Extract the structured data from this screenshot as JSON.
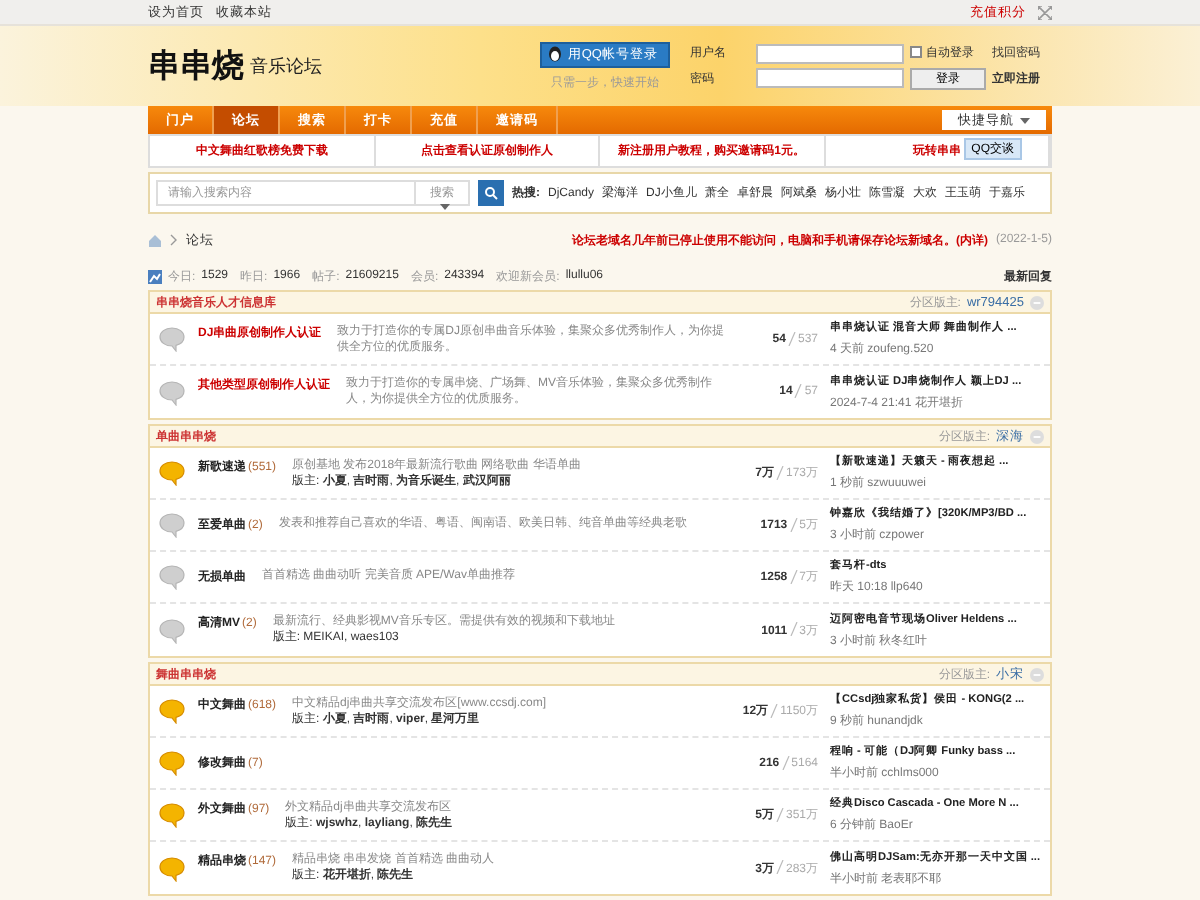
{
  "topbar": {
    "links": [
      "设为首页",
      "收藏本站"
    ],
    "credit_link": "充值积分"
  },
  "header": {
    "logo_main": "串串烧",
    "logo_sub": "音乐论坛",
    "qq_login": "用QQ帐号登录",
    "qq_hint": "只需一步，快速开始",
    "username_label": "用户名",
    "password_label": "密码",
    "auto_login": {
      "label": "自动登录",
      "checked": false
    },
    "find_password": "找回密码",
    "login_button": "登录",
    "register": "立即注册"
  },
  "nav": {
    "items": [
      {
        "label": "门户",
        "selected": false
      },
      {
        "label": "论坛",
        "selected": true
      },
      {
        "label": "搜索",
        "selected": false
      },
      {
        "label": "打卡",
        "selected": false
      },
      {
        "label": "充值",
        "selected": false
      },
      {
        "label": "邀请码",
        "selected": false
      }
    ],
    "quick_nav": "快捷导航"
  },
  "promo": [
    "中文舞曲红歌榜免费下载",
    "点击查看认证原创制作人",
    "新注册用户教程，购买邀请码1元。",
    "玩转串串"
  ],
  "qq_chat": "QQ交谈",
  "search": {
    "placeholder": "请输入搜索内容",
    "scope": "搜索",
    "hot_label": "热搜:",
    "hot": [
      "DjCandy",
      "梁海洋",
      "DJ小鱼儿",
      "萧全",
      "卓舒晨",
      "阿斌桑",
      "杨小壮",
      "陈雪凝",
      "大欢",
      "王玉萌",
      "于嘉乐"
    ]
  },
  "breadcrumb": {
    "current": "论坛",
    "notice": "论坛老域名几年前已停止使用不能访问，电脑和手机请保存论坛新域名。(内详)",
    "date": "(2022-1-5)"
  },
  "stats": [
    {
      "label": "今日:",
      "value": "1529"
    },
    {
      "label": "昨日:",
      "value": "1966"
    },
    {
      "label": "帖子:",
      "value": "21609215"
    },
    {
      "label": "会员:",
      "value": "243394"
    },
    {
      "label": "欢迎新会员:",
      "value": "llullu06"
    }
  ],
  "latest_reply": "最新回复",
  "sections": [
    {
      "title": "串串烧音乐人才信息库",
      "moderator_label": "分区版主:",
      "moderator": "wr794425",
      "expanded": true,
      "forums": [
        {
          "kind": "old",
          "highlight": true,
          "name": "DJ串曲原创制作人认证",
          "desc": "致力于打造你的专属DJ原创串曲音乐体验，集聚众多优秀制作人，为你提供全方位的优质服务。",
          "threads": "54",
          "posts": "537",
          "last_title": "串串烧认证 混音大师 舞曲制作人 ...",
          "last_meta": "4 天前 zoufeng.520"
        },
        {
          "kind": "old",
          "highlight": true,
          "name": "其他类型原创制作人认证",
          "desc": "致力于打造你的专属串烧、广场舞、MV音乐体验，集聚众多优秀制作人，为你提供全方位的优质服务。",
          "threads": "14",
          "posts": "57",
          "last_title": "串串烧认证 DJ串烧制作人 颖上DJ ...",
          "last_meta": "2024-7-4 21:41 花开堪折"
        }
      ]
    },
    {
      "title": "单曲串串烧",
      "moderator_label": "分区版主:",
      "moderator": "深海",
      "expanded": true,
      "forums": [
        {
          "kind": "new",
          "highlight": false,
          "name": "新歌速递",
          "today": "(551)",
          "desc": "原创基地 发布2018年最新流行歌曲 网络歌曲 华语单曲",
          "mods": "版主: **小夏**, **吉时雨**, **为音乐诞生**, **武汉阿丽**",
          "threads": "7万",
          "posts": "173万",
          "last_title": "【新歌速递】天籁天 - 雨夜想起 ...",
          "last_meta": "1 秒前 szwuuuwei"
        },
        {
          "kind": "old",
          "highlight": false,
          "name": "至爱单曲",
          "today": "(2)",
          "desc": "发表和推荐自己喜欢的华语、粤语、闽南语、欧美日韩、纯音单曲等经典老歌",
          "threads": "1713",
          "posts": "5万",
          "last_title": "钟嘉欣《我结婚了》[320K/MP3/BD ...",
          "last_meta": "3 小时前 czpower"
        },
        {
          "kind": "old",
          "highlight": false,
          "name": "无损单曲",
          "desc": "首首精选 曲曲动听 完美音质 APE/Wav单曲推荐",
          "threads": "1258",
          "posts": "7万",
          "last_title": "套马杆-dts",
          "last_meta": "昨天 10:18 llp640"
        },
        {
          "kind": "old",
          "highlight": false,
          "name": "高清MV",
          "today": "(2)",
          "desc": "最新流行、经典影视MV音乐专区。需提供有效的视频和下载地址",
          "mods": "版主: MEIKAI, waes103",
          "threads": "1011",
          "posts": "3万",
          "last_title": "迈阿密电音节现场Oliver Heldens ...",
          "last_meta": "3 小时前 秋冬红叶"
        }
      ]
    },
    {
      "title": "舞曲串串烧",
      "moderator_label": "分区版主:",
      "moderator": "小宋",
      "expanded": true,
      "forums": [
        {
          "kind": "new",
          "highlight": false,
          "name": "中文舞曲",
          "today": "(618)",
          "desc": "中文精品dj串曲共享交流发布区[www.ccsdj.com]",
          "mods": "版主: **小夏**, **吉时雨**, **viper**, **星河万里**",
          "threads": "12万",
          "posts": "1150万",
          "last_title": "【CCsdj独家私货】侯田 - KONG(2 ...",
          "last_meta": "9 秒前 hunandjdk"
        },
        {
          "kind": "new",
          "highlight": false,
          "name": "修改舞曲",
          "today": "(7)",
          "threads": "216",
          "posts": "5164",
          "last_title": "程响 - 可能（DJ阿卿 Funky bass ...",
          "last_meta": "半小时前 cchlms000"
        },
        {
          "kind": "new",
          "highlight": false,
          "name": "外文舞曲",
          "today": "(97)",
          "desc": "外文精品dj串曲共享交流发布区",
          "mods": "版主: **wjswhz**, **layliang**, **陈先生**",
          "threads": "5万",
          "posts": "351万",
          "last_title": "经典Disco Cascada - One More N ...",
          "last_meta": "6 分钟前 BaoEr"
        },
        {
          "kind": "new",
          "highlight": false,
          "name": "精品串烧",
          "today": "(147)",
          "desc": "精品串烧 串串发烧 首首精选 曲曲动人",
          "mods": "版主: **花开堪折**, **陈先生**",
          "threads": "3万",
          "posts": "283万",
          "last_title": "佛山高明DJSam:无亦开那一天中文国 ...",
          "last_meta": "半小时前 老表耶不耶"
        }
      ]
    }
  ]
}
